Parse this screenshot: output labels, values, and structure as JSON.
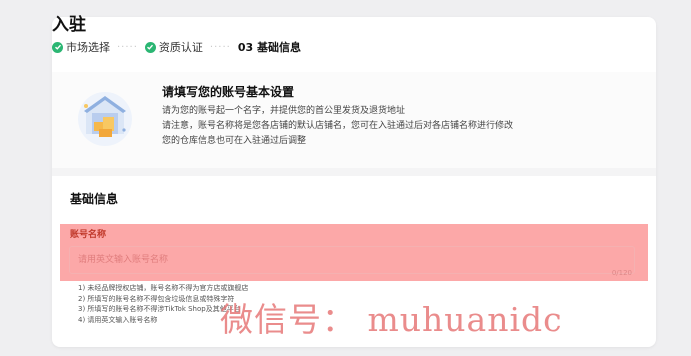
{
  "page": {
    "title": "入驻"
  },
  "steps": [
    {
      "label": "市场选择",
      "status": "done"
    },
    {
      "label": "资质认证",
      "status": "done"
    },
    {
      "label": "03 基础信息",
      "status": "current"
    }
  ],
  "step_separator": "·····",
  "info": {
    "title": "请填写您的账号基本设置",
    "lines": [
      "请为您的账号起一个名字，并提供您的首公里发货及退货地址",
      "请注意，账号名称将是您各店铺的默认店铺名，您可在入驻通过后对各店铺名称进行修改",
      "您的仓库信息也可在入驻通过后调整"
    ]
  },
  "section": {
    "title": "基础信息"
  },
  "account_field": {
    "label": "账号名称",
    "placeholder": "请用英文输入账号名称",
    "value": "",
    "counter": "0/120"
  },
  "rules": [
    "1) 未经品牌授权店铺，账号名称不得为官方店或旗舰店",
    "2) 所填写的账号名称不得包含垃圾信息或特殊字符",
    "3) 所填写的账号名称不得涉TikTok Shop及其他平台",
    "4) 请用英文输入账号名称"
  ],
  "watermark": "微信号： muhuanidc",
  "colors": {
    "accent_green": "#2bb673",
    "highlight_red": "#fca8a8",
    "background": "#efeff1"
  }
}
